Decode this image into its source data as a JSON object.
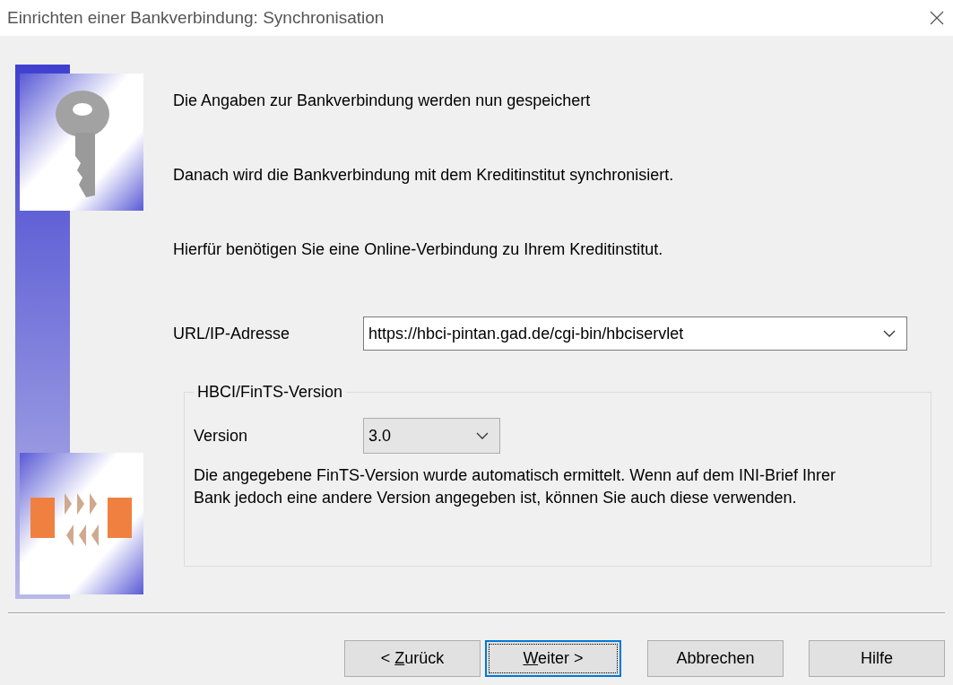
{
  "window": {
    "title": "Einrichten einer Bankverbindung: Synchronisation"
  },
  "intro": [
    "Die Angaben zur Bankverbindung werden nun gespeichert",
    "Danach wird die Bankverbindung mit dem Kreditinstitut synchronisiert.",
    "Hierfür benötigen Sie eine Online-Verbindung zu Ihrem Kreditinstitut."
  ],
  "url": {
    "label": "URL/IP-Adresse",
    "value": "https://hbci-pintan.gad.de/cgi-bin/hbciservlet"
  },
  "version_group": {
    "legend": "HBCI/FinTS-Version",
    "label": "Version",
    "value": "3.0",
    "note": "Die angegebene FinTS-Version wurde automatisch ermittelt. Wenn auf dem INI-Brief Ihrer Bank jedoch eine andere Version angegeben ist, können Sie auch diese verwenden."
  },
  "buttons": [
    {
      "before": "< ",
      "key": "Z",
      "after": "urück",
      "default": false
    },
    {
      "key": "W",
      "after": "eiter >",
      "default": true
    },
    {
      "after": "Abbrechen",
      "default": false
    },
    {
      "after": "Hilfe",
      "default": false
    }
  ]
}
